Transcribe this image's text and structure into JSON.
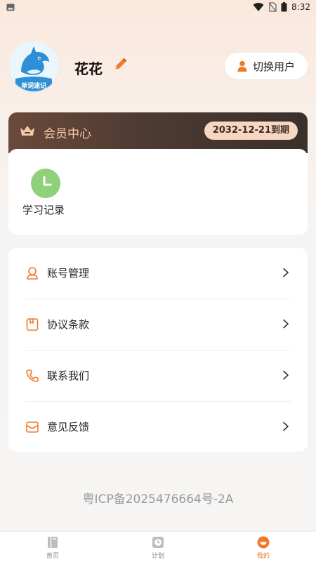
{
  "status_bar": {
    "time": "8:32"
  },
  "profile": {
    "username": "花花",
    "avatar_text": "单词速记",
    "switch_user_label": "切换用户"
  },
  "vip": {
    "title": "会员中心",
    "expiry": "2032-12-21到期"
  },
  "records": {
    "study_record_label": "学习记录"
  },
  "menu": {
    "items": [
      {
        "label": "账号管理",
        "icon": "account-icon"
      },
      {
        "label": "协议条款",
        "icon": "agreement-icon"
      },
      {
        "label": "联系我们",
        "icon": "phone-icon"
      },
      {
        "label": "意见反馈",
        "icon": "feedback-icon"
      }
    ]
  },
  "footer": {
    "icp": "粤ICP备2025476664号-2A"
  },
  "tabbar": {
    "tabs": [
      {
        "label": "首页",
        "active": false
      },
      {
        "label": "计划",
        "active": false
      },
      {
        "label": "我的",
        "active": true
      }
    ]
  },
  "colors": {
    "accent": "#ee7a2a",
    "vip_title": "#f4c9a8",
    "badge_bg": "#f7d7c1",
    "clock_green": "#8fd07a"
  }
}
